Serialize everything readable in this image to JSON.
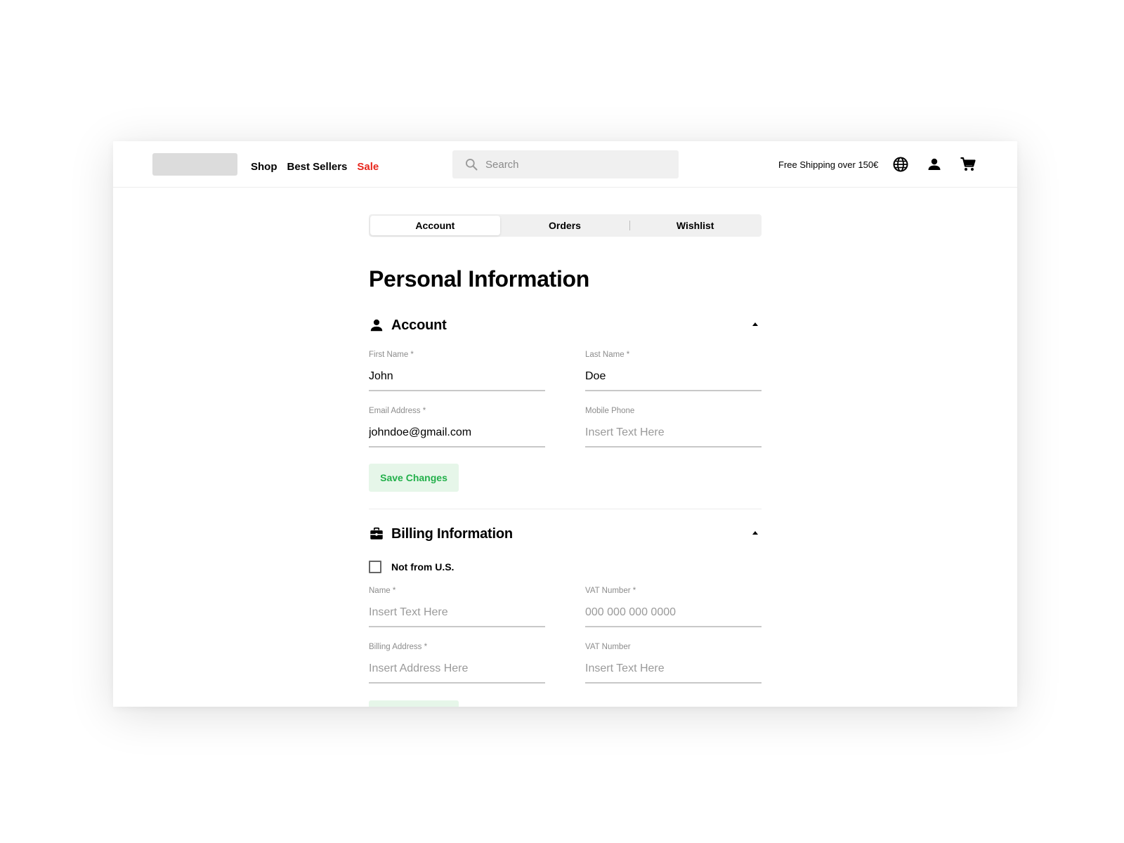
{
  "header": {
    "nav": [
      "Shop",
      "Best Sellers",
      "Sale"
    ],
    "search_placeholder": "Search",
    "shipping_text": "Free Shipping over 150€",
    "icons": [
      "globe-icon",
      "user-icon",
      "cart-icon"
    ]
  },
  "tabs": [
    "Account",
    "Orders",
    "Wishlist"
  ],
  "active_tab": "Account",
  "page_title": "Personal Information",
  "account_section": {
    "title": "Account",
    "fields": {
      "first_name": {
        "label": "First Name *",
        "value": "John",
        "placeholder": ""
      },
      "last_name": {
        "label": "Last Name *",
        "value": "Doe",
        "placeholder": ""
      },
      "email": {
        "label": "Email Address *",
        "value": "johndoe@gmail.com",
        "placeholder": ""
      },
      "mobile": {
        "label": "Mobile Phone",
        "value": "",
        "placeholder": "Insert Text Here"
      }
    },
    "save_label": "Save Changes"
  },
  "billing_section": {
    "title": "Billing Information",
    "checkbox_label": "Not from U.S.",
    "checkbox_checked": false,
    "fields": {
      "name": {
        "label": "Name *",
        "value": "",
        "placeholder": "Insert Text Here"
      },
      "vat_required": {
        "label": "VAT Number *",
        "value": "",
        "placeholder": "000 000 000 0000"
      },
      "billing_address": {
        "label": "Billing Address *",
        "value": "",
        "placeholder": "Insert Address Here"
      },
      "vat": {
        "label": "VAT Number",
        "value": "",
        "placeholder": "Insert Text Here"
      }
    }
  },
  "colors": {
    "sale": "#e8261c",
    "save_button_bg": "#e6f6e9",
    "save_button_text": "#23b04b"
  }
}
